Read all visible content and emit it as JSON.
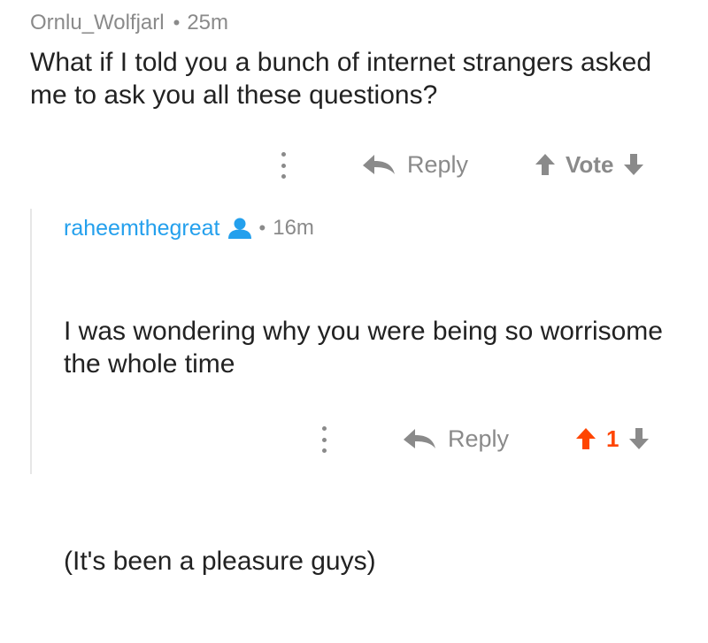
{
  "parent": {
    "username": "Ornlu_Wolfjarl",
    "separator": "•",
    "age": "25m",
    "body": "What if I told you a bunch of internet strangers asked me to ask you all these questions?",
    "actions": {
      "reply_label": "Reply",
      "vote_label": "Vote",
      "more_icon": "more-vertical-icon",
      "reply_icon": "reply-arrow-icon",
      "upvote_icon": "upvote-arrow-icon",
      "downvote_icon": "downvote-arrow-icon"
    }
  },
  "child": {
    "username": "raheemthegreat",
    "user_badge_icon": "op-user-icon",
    "separator": "•",
    "age": "16m",
    "body_paragraphs": [
      "I was wondering why you were being so worrisome the whole time",
      "(It's been a pleasure guys)"
    ],
    "actions": {
      "reply_label": "Reply",
      "score": "1",
      "upvoted": true,
      "more_icon": "more-vertical-icon",
      "reply_icon": "reply-arrow-icon",
      "upvote_icon": "upvote-arrow-icon",
      "downvote_icon": "downvote-arrow-icon"
    }
  },
  "colors": {
    "username_link": "#24a0ed",
    "upvote_active": "#ff4500",
    "muted_text": "#8a8a8a",
    "thread_line": "#e6e6e6",
    "body_text": "#222222"
  }
}
